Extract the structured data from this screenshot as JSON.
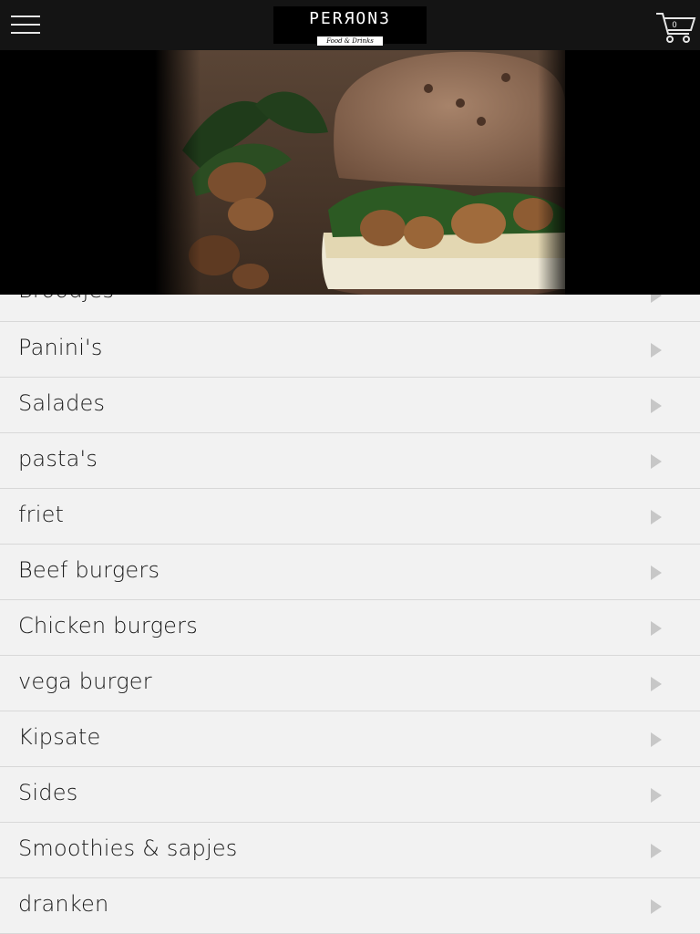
{
  "header": {
    "logo_text": "PERЯON3",
    "logo_tagline": "Food & Drinks",
    "cart_count": "0"
  },
  "menu": {
    "items": [
      {
        "label": "Broodjes"
      },
      {
        "label": "Panini's"
      },
      {
        "label": "Salades"
      },
      {
        "label": "pasta's"
      },
      {
        "label": "friet"
      },
      {
        "label": "Beef burgers"
      },
      {
        "label": "Chicken burgers"
      },
      {
        "label": "vega burger"
      },
      {
        "label": "Kipsate"
      },
      {
        "label": "Sides"
      },
      {
        "label": "Smoothies & sapjes"
      },
      {
        "label": "dranken"
      }
    ]
  },
  "icons": {
    "menu": "hamburger-menu-icon",
    "cart": "shopping-cart-icon",
    "arrow": "chevron-right-icon"
  },
  "colors": {
    "header_bg": "#141414",
    "list_bg": "#f2f2f2",
    "divider": "#d8d8d8",
    "arrow": "#c7c7c7"
  }
}
